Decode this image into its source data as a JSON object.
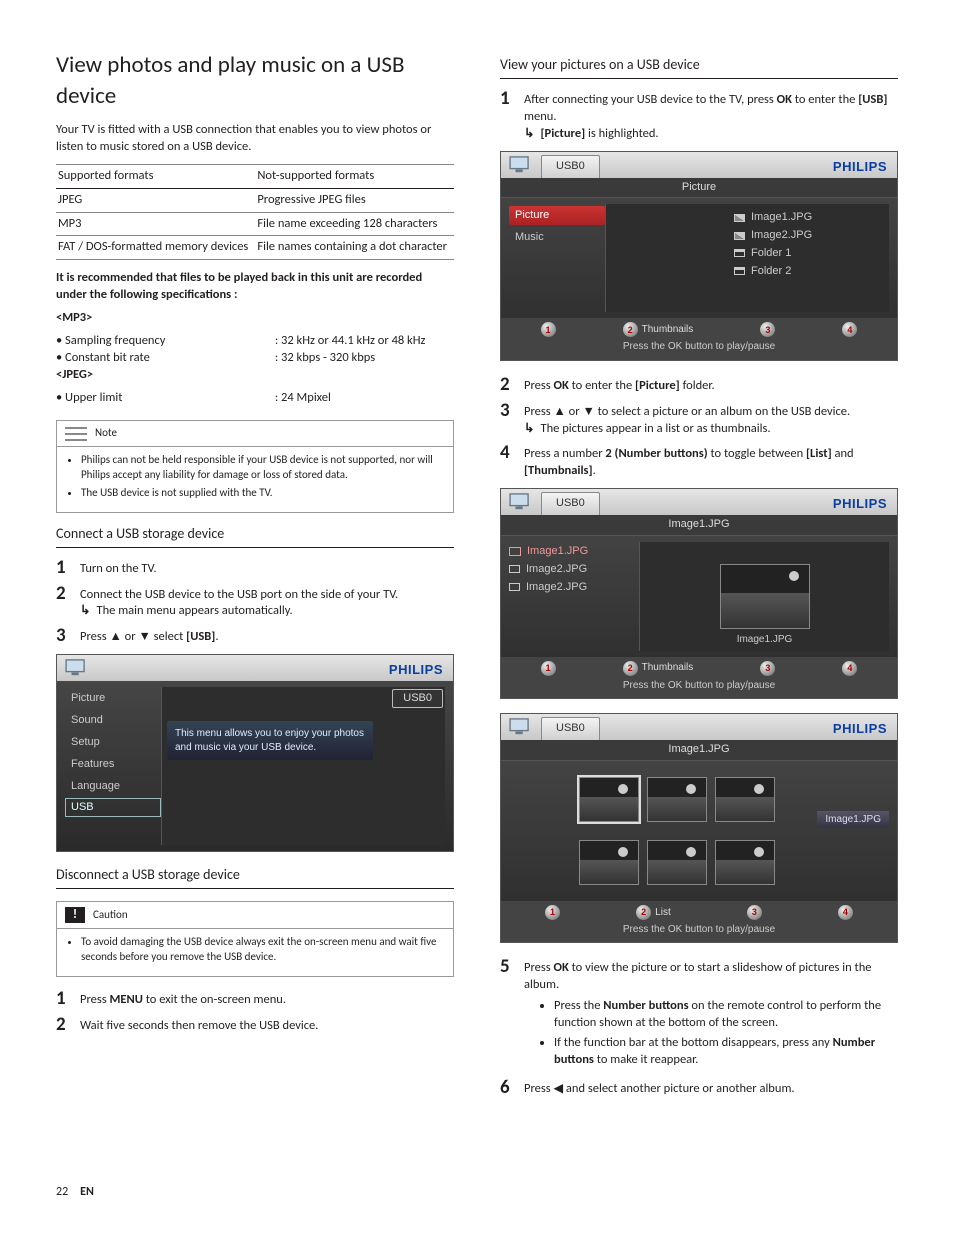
{
  "left": {
    "title": "View photos and play music on a USB device",
    "intro": "Your TV is fitted with a USB connection that enables you to view photos or listen to music stored on a USB device.",
    "table": {
      "h1": "Supported formats",
      "h2": "Not-supported formats",
      "rows": [
        {
          "a": "JPEG",
          "b": "Progressive JPEG files"
        },
        {
          "a": "MP3",
          "b": "File name exceeding 128 characters"
        },
        {
          "a": "FAT / DOS-formatted memory devices",
          "b": "File names containing a dot character"
        }
      ]
    },
    "spec": {
      "lead": "It is recommended that files to be played back in this unit are recorded under the following specifications :",
      "mp3label": "<MP3>",
      "mp3_items": [
        {
          "l": "• Sampling frequency",
          "v": ": 32 kHz or 44.1 kHz or 48 kHz"
        },
        {
          "l": "• Constant bit rate",
          "v": ": 32 kbps - 320 kbps"
        }
      ],
      "jpeglabel": "<JPEG>",
      "jpeg_items": [
        {
          "l": "• Upper limit",
          "v": ": 24 Mpixel"
        }
      ]
    },
    "note": {
      "title": "Note",
      "items": [
        "Philips can not be held responsible if your USB device is not supported, nor will Philips accept any liability for damage or loss of stored data.",
        "The USB device is not supplied with the TV."
      ]
    },
    "connect": {
      "heading": "Connect a USB storage device",
      "steps": [
        {
          "n": "1",
          "t": "Turn on the TV."
        },
        {
          "n": "2",
          "t": "Connect the USB device to the USB port on the side of your TV.",
          "sub": "The main menu appears automatically."
        },
        {
          "n": "3",
          "t_pre": "Press ",
          "t_mid": " or ",
          "t_post": " select ",
          "bold": "[USB]",
          "end": "."
        }
      ]
    },
    "tv1": {
      "brand": "PHILIPS",
      "menu": [
        "Picture",
        "Sound",
        "Setup",
        "Features",
        "Language",
        "USB"
      ],
      "tooltip": "This menu allows you to enjoy your photos and music via your USB device.",
      "pill": "USB0"
    },
    "disconnect": {
      "heading": "Disconnect a USB storage device",
      "caution_title": "Caution",
      "caution_text": "To avoid damaging the USB device always exit the on-screen menu and wait five seconds before you remove the USB device.",
      "steps": [
        {
          "n": "1",
          "pre": "Press ",
          "b": "MENU",
          "post": " to exit the on-screen menu."
        },
        {
          "n": "2",
          "t": "Wait five seconds then remove the USB device."
        }
      ]
    }
  },
  "right": {
    "heading": "View your pictures on a USB device",
    "step1": {
      "n": "1",
      "pre": "After connecting your USB device to the TV, press ",
      "b": "OK",
      "post": " to enter the ",
      "b2": "[USB]",
      "post2": " menu.",
      "sub_b": "[Picture]",
      "sub_post": " is highlighted."
    },
    "tv2": {
      "brand": "PHILIPS",
      "tab": "USB0",
      "header": "Picture",
      "side": [
        "Picture",
        "Music"
      ],
      "files": [
        "Image1.JPG",
        "Image2.JPG",
        "Folder 1",
        "Folder 2"
      ],
      "footer_hint": "Press the OK button to play/pause",
      "footer_label": "Thumbnails"
    },
    "step2": {
      "n": "2",
      "pre": "Press ",
      "b": "OK",
      "mid": " to enter the ",
      "b2": "[Picture]",
      "post": " folder."
    },
    "step3": {
      "n": "3",
      "t": "Press ▲ or ▼ to select a picture or an album on the USB device.",
      "sub": "The pictures appear in a list or as thumbnails."
    },
    "step4": {
      "n": "4",
      "pre": "Press a number ",
      "b": "2 (Number buttons)",
      "mid": " to toggle between ",
      "b2": "[List]",
      "mid2": " and ",
      "b3": "[Thumbnails]",
      "post": "."
    },
    "tv3": {
      "brand": "PHILIPS",
      "tab": "USB0",
      "header": "Image1.JPG",
      "files": [
        "Image1.JPG",
        "Image2.JPG",
        "Image2.JPG"
      ],
      "preview_label": "Image1.JPG",
      "footer_hint": "Press the OK button to play/pause",
      "footer_label": "Thumbnails"
    },
    "tv4": {
      "brand": "PHILIPS",
      "tab": "USB0",
      "header": "Image1.JPG",
      "right_pill": "Image1.JPG",
      "footer_hint": "Press the OK button to play/pause",
      "footer_label": "List"
    },
    "step5": {
      "n": "5",
      "pre": "Press ",
      "b": "OK",
      "post": " to view the picture or to start a slideshow of pictures in the album.",
      "bullets": [
        {
          "pre": "Press the ",
          "b": "Number buttons",
          "post": " on the remote control to perform the function shown at the bottom of the screen."
        },
        {
          "pre": "If the function bar at the bottom disappears, press any ",
          "b": "Number buttons",
          "post": " to make it reappear."
        }
      ]
    },
    "step6": {
      "n": "6",
      "t": "Press ◀ and select another picture or another album."
    }
  },
  "footer": {
    "page": "22",
    "lang": "EN"
  }
}
